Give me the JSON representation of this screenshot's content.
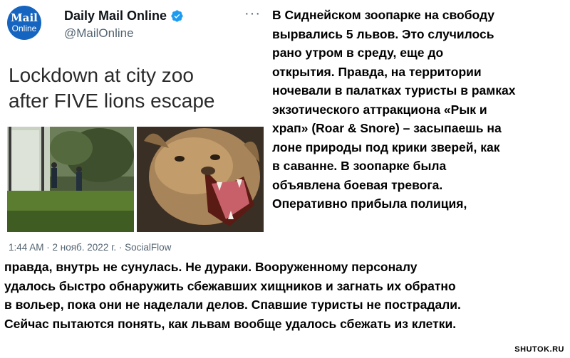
{
  "tweet": {
    "avatar_line1": "Mail",
    "avatar_line2": "Online",
    "author_name": "Daily Mail Online",
    "author_handle": "@MailOnline",
    "more_label": "···",
    "headline_line1": "Lockdown at city zoo",
    "headline_line2": "after FIVE lions escape",
    "meta": "1:44 AM · 2 нояб. 2022 г. · SocialFlow",
    "verified_color": "#1d9bf0",
    "avatar_color": "#1565c0"
  },
  "right_text_lines": [
    "В Сиднейском зоопарке на свободу",
    "вырвались 5 львов. Это случилось",
    "рано утром в среду, еще до",
    "открытия. Правда, на территории",
    "ночевали в палатках туристы в рамках",
    "экзотического аттракциона «Рык и",
    "храп» (Roar & Snore) – засыпаешь на",
    "лоне природы под крики зверей, как",
    "в саванне. В зоопарке была",
    "объявлена боевая тревога.",
    "Оперативно прибыла полиция,"
  ],
  "bottom_text_lines": [
    "правда, внутрь не сунулась. Не дураки. Вооруженному персоналу",
    "удалось быстро обнаружить сбежавших хищников и загнать их обратно",
    "в вольер, пока они не наделали делов. Спавшие туристы не пострадали.",
    "Сейчас пытаются понять, как львам вообще удалось сбежать из клетки."
  ],
  "watermark": "SHUTOK.RU",
  "images": [
    {
      "icon": "zoo-photo"
    },
    {
      "icon": "lioness-roaring-photo"
    }
  ]
}
